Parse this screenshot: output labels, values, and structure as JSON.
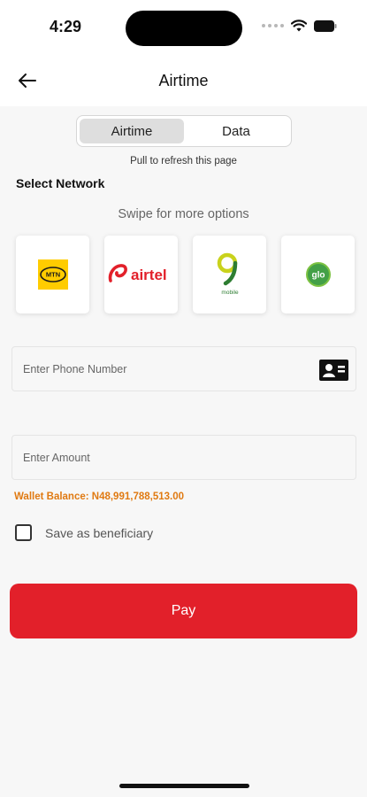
{
  "status_bar": {
    "time": "4:29"
  },
  "header": {
    "title": "Airtime"
  },
  "tabs": [
    {
      "label": "Airtime",
      "active": true
    },
    {
      "label": "Data",
      "active": false
    }
  ],
  "refresh_hint": "Pull to refresh this page",
  "select_network_label": "Select Network",
  "swipe_hint": "Swipe for more options",
  "networks": [
    {
      "name": "MTN",
      "logo_text": "MTN",
      "color": "#ffcc00"
    },
    {
      "name": "airtel",
      "logo_text": "airtel",
      "color": "#e2202a"
    },
    {
      "name": "9mobile",
      "logo_text": "mobile",
      "color": "#2e7d32"
    },
    {
      "name": "glo",
      "logo_text": "glo",
      "color": "#43a047"
    }
  ],
  "phone_field": {
    "placeholder": "Enter Phone Number",
    "value": ""
  },
  "amount_field": {
    "placeholder": "Enter Amount",
    "value": ""
  },
  "wallet_balance": "Wallet Balance: N48,991,788,513.00",
  "save_beneficiary": {
    "label": "Save as beneficiary",
    "checked": false
  },
  "pay_button": {
    "label": "Pay"
  },
  "colors": {
    "accent": "#e2202a",
    "wallet_text": "#e07a12",
    "background": "#f7f7f7"
  }
}
